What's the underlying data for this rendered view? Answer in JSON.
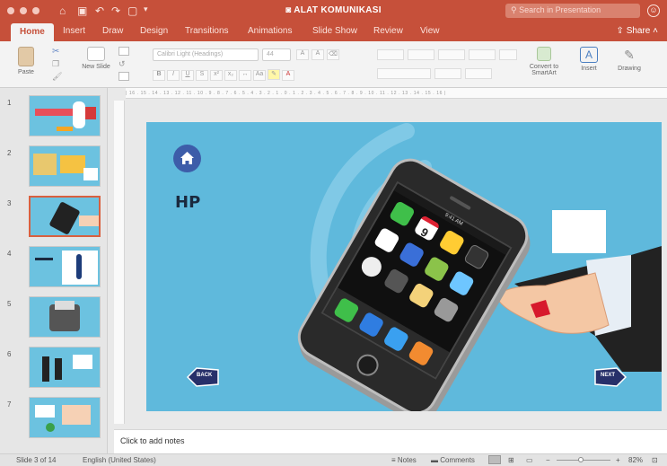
{
  "window": {
    "title": "ALAT KOMUNIKASI"
  },
  "search": {
    "placeholder": "Search in Presentation"
  },
  "toolbar": {
    "share_label": "Share"
  },
  "tabs": [
    {
      "label": "Home",
      "active": true
    },
    {
      "label": "Insert"
    },
    {
      "label": "Draw"
    },
    {
      "label": "Design"
    },
    {
      "label": "Transitions"
    },
    {
      "label": "Animations"
    },
    {
      "label": "Slide Show"
    },
    {
      "label": "Review"
    },
    {
      "label": "View"
    }
  ],
  "ribbon": {
    "paste_label": "Paste",
    "new_slide_label": "New Slide",
    "font_name": "Calibri Light (Headings)",
    "font_size": "44",
    "convert_label": "Convert to SmartArt",
    "insert_label": "Insert",
    "drawing_label": "Drawing"
  },
  "thumbnails": [
    "1",
    "2",
    "3",
    "4",
    "5",
    "6",
    "7"
  ],
  "slide": {
    "title": "HP",
    "back_label": "BACK",
    "next_label": "NEXT",
    "phone_time": "9:41 AM",
    "calendar_day": "9"
  },
  "notes": {
    "placeholder": "Click to add notes"
  },
  "status": {
    "slide_info": "Slide 3 of 14",
    "language": "English (United States)",
    "notes_label": "Notes",
    "comments_label": "Comments",
    "zoom": "82%"
  },
  "colors": {
    "accent": "#c6503a",
    "slide_bg": "#5fb9dc",
    "home_button": "#3d5da9"
  }
}
